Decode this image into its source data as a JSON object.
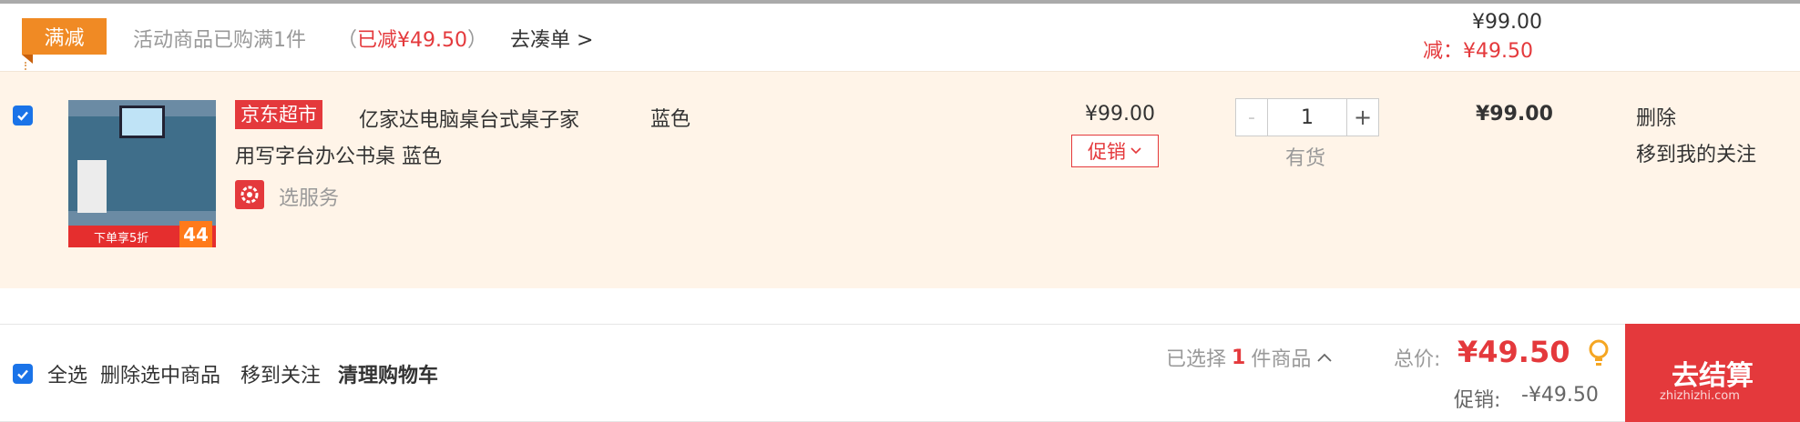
{
  "promo": {
    "tag": "满减",
    "text": "活动商品已购满1件",
    "reduce_open": "（",
    "reduce_value": "已减¥49.50",
    "reduce_close": "）",
    "goto": "去凑单 >",
    "price": "¥99.00",
    "minus": "减：¥49.50"
  },
  "item": {
    "checked": true,
    "shop_tag": "京东超市",
    "title_line1": "亿家达电脑桌台式桌子家",
    "title_line2": "用写字台办公书桌 蓝色",
    "service": "选服务",
    "color": "蓝色",
    "unit_price": "¥99.00",
    "promo_button": "促销",
    "quantity": "1",
    "qty_minus": "-",
    "qty_plus": "+",
    "stock": "有货",
    "subtotal": "¥99.00",
    "actions": {
      "delete": "删除",
      "move_to_favorites": "移到我的关注"
    },
    "thumb": {
      "banner": "下单享5折",
      "number": "44"
    }
  },
  "footer": {
    "select_all": "全选",
    "delete_selected": "删除选中商品",
    "move_to_favorites": "移到关注",
    "clear_cart": "清理购物车",
    "selected_prefix": "已选择",
    "selected_count": "1",
    "selected_suffix": "件商品",
    "total_label": "总价:",
    "total": "¥49.50",
    "promo_label": "促销:",
    "promo_value": "-¥49.50",
    "checkout": "去结算",
    "watermark": "zhizhizhi.com"
  },
  "colors": {
    "accent_red": "#e4393c",
    "promo_orange": "#f08a24",
    "row_bg": "#fff4e8",
    "checkbox_blue": "#1a73e8"
  },
  "icons": [
    "checkbox-checked-icon",
    "service-gear-icon",
    "chevron-down-icon",
    "chevron-up-icon",
    "lightbulb-icon"
  ]
}
